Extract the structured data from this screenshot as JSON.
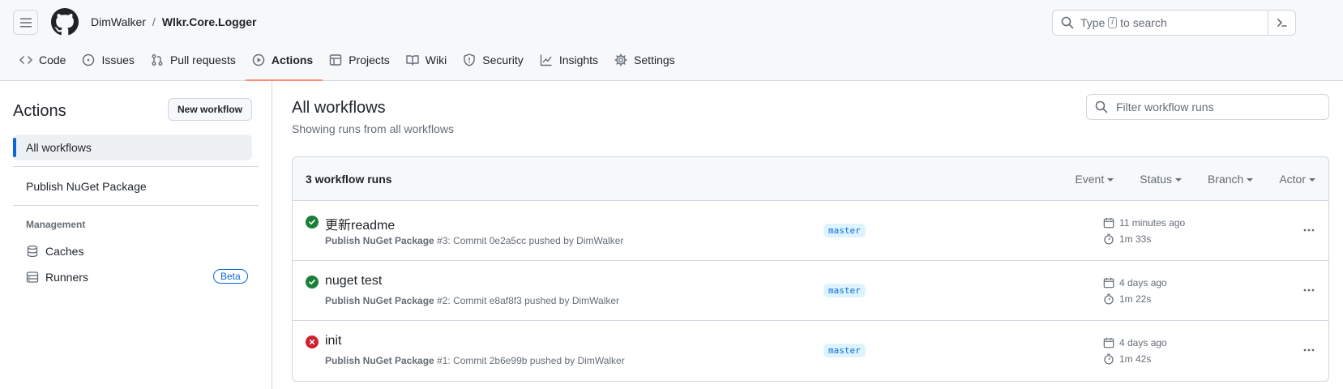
{
  "header": {
    "owner": "DimWalker",
    "separator": "/",
    "repo": "Wlkr.Core.Logger",
    "search_prefix": "Type",
    "search_key": "/",
    "search_suffix": "to search"
  },
  "nav": [
    {
      "label": "Code",
      "icon": "code-icon"
    },
    {
      "label": "Issues",
      "icon": "issue-icon"
    },
    {
      "label": "Pull requests",
      "icon": "pull-request-icon"
    },
    {
      "label": "Actions",
      "icon": "play-icon"
    },
    {
      "label": "Projects",
      "icon": "table-icon"
    },
    {
      "label": "Wiki",
      "icon": "book-icon"
    },
    {
      "label": "Security",
      "icon": "shield-icon"
    },
    {
      "label": "Insights",
      "icon": "graph-icon"
    },
    {
      "label": "Settings",
      "icon": "gear-icon"
    }
  ],
  "sidebar": {
    "title": "Actions",
    "new_workflow": "New workflow",
    "all_workflows": "All workflows",
    "workflows": [
      "Publish NuGet Package"
    ],
    "management_label": "Management",
    "caches": "Caches",
    "runners": "Runners",
    "beta": "Beta"
  },
  "main": {
    "title": "All workflows",
    "subtitle": "Showing runs from all workflows",
    "filter_placeholder": "Filter workflow runs",
    "runs_count": "3 workflow runs",
    "filters": [
      "Event",
      "Status",
      "Branch",
      "Actor"
    ],
    "runs": [
      {
        "title": "更新readme",
        "workflow": "Publish NuGet Package",
        "meta": " #3: Commit 0e2a5cc pushed by DimWalker",
        "branch": "master",
        "time": "11 minutes ago",
        "duration": "1m 33s",
        "status": "success"
      },
      {
        "title": "nuget test",
        "workflow": "Publish NuGet Package",
        "meta": " #2: Commit e8af8f3 pushed by DimWalker",
        "branch": "master",
        "time": "4 days ago",
        "duration": "1m 22s",
        "status": "success"
      },
      {
        "title": "init",
        "workflow": "Publish NuGet Package",
        "meta": " #1: Commit 2b6e99b pushed by DimWalker",
        "branch": "master",
        "time": "4 days ago",
        "duration": "1m 42s",
        "status": "failure"
      }
    ]
  },
  "colors": {
    "success": "#1a7f37",
    "failure": "#cf222e",
    "accent": "#0969da",
    "underline": "#fd8c73"
  }
}
